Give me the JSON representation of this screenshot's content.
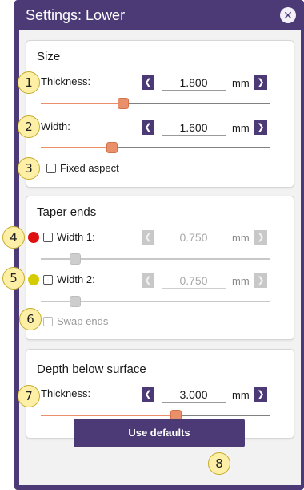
{
  "window": {
    "title": "Settings: Lower",
    "close_glyph": "✕",
    "accent": "#4b3a76"
  },
  "size": {
    "title": "Size",
    "thickness": {
      "label": "Thickness:",
      "value": "1.800",
      "unit": "mm",
      "slider_fraction": 0.36
    },
    "width": {
      "label": "Width:",
      "value": "1.600",
      "unit": "mm",
      "slider_fraction": 0.31
    },
    "fixed_aspect": {
      "label": "Fixed aspect",
      "checked": false
    }
  },
  "taper": {
    "title": "Taper ends",
    "width1": {
      "label": "Width 1:",
      "value": "0.750",
      "unit": "mm",
      "dot_color": "#e01010",
      "slider_fraction": 0.15
    },
    "width2": {
      "label": "Width 2:",
      "value": "0.750",
      "unit": "mm",
      "dot_color": "#d4cc00",
      "slider_fraction": 0.15
    },
    "swap_ends": {
      "label": "Swap ends",
      "checked": false
    }
  },
  "depth": {
    "title": "Depth below surface",
    "thickness": {
      "label": "Thickness:",
      "value": "3.000",
      "unit": "mm",
      "slider_fraction": 0.59
    }
  },
  "defaults_button": {
    "label": "Use defaults"
  },
  "icons": {
    "left_arrow": "❮",
    "right_arrow": "❯"
  },
  "callouts": [
    "1",
    "2",
    "3",
    "4",
    "5",
    "6",
    "7",
    "8"
  ],
  "colors": {
    "slider_active": "#e9906a",
    "callout_fill": "#fdf0a6"
  }
}
